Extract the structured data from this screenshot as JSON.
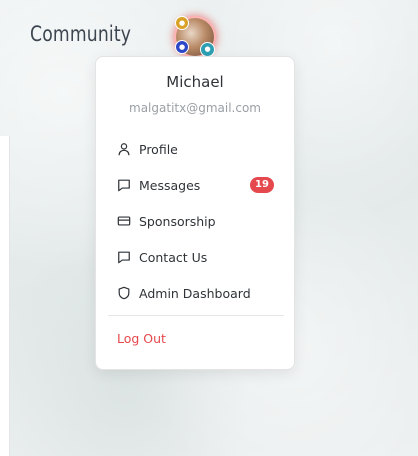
{
  "header": {
    "brand": "Community"
  },
  "avatar": {
    "badges": [
      "trophy-badge",
      "shield-badge",
      "globe-badge"
    ],
    "ring_color": "#e53e3e"
  },
  "menu": {
    "user_name": "Michael",
    "user_email": "malgatitx@gmail.com",
    "items": [
      {
        "label": "Profile",
        "icon": "user-icon"
      },
      {
        "label": "Messages",
        "icon": "message-icon",
        "count": "19"
      },
      {
        "label": "Sponsorship",
        "icon": "credit-card-icon"
      },
      {
        "label": "Contact Us",
        "icon": "message-icon"
      },
      {
        "label": "Admin Dashboard",
        "icon": "shield-icon"
      }
    ],
    "logout_label": "Log Out"
  },
  "colors": {
    "danger": "#e5484d",
    "text": "#2f3338",
    "muted": "#9aa0a6"
  }
}
